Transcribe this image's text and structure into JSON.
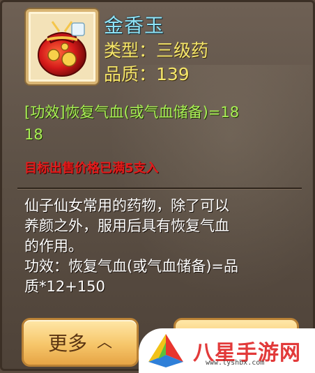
{
  "item": {
    "name": "金香玉",
    "type_line": "类型：三级药",
    "quality_line": "品质：139",
    "effect_text": "[功效]恢复气血(或气血储备)=18",
    "effect_value": "18",
    "red_line": "目标出售价格已满5支入",
    "description": [
      "仙子仙女常用的药物，除了可以",
      "养颜之外，服用后具有恢复气血",
      "的作用。",
      "功效：恢复气血(或气血储备)=品",
      "质*12+150"
    ]
  },
  "buttons": {
    "more_label": "更多",
    "more_icon": "chevron-up-icon"
  },
  "watermark": {
    "text": "八星手游网",
    "url": "www.lyshbx.com"
  },
  "colors": {
    "name": "#8fe3f5",
    "attributes": "#f5e66a",
    "effect": "#a9ef55",
    "warning": "#e21b1b",
    "button": "#f6c66a"
  }
}
